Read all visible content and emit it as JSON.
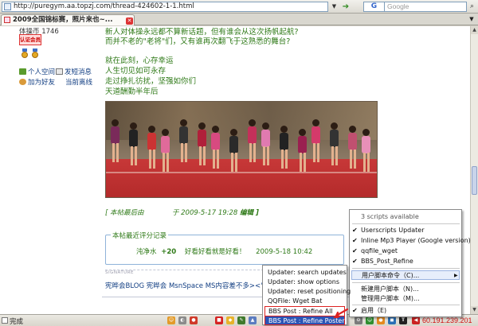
{
  "browser": {
    "url": "http://puregym.aa.topzj.com/thread-424602-1-1.html",
    "tab_title": "2009全国锦标赛，照片来也~...",
    "search_engine": "G",
    "search_placeholder": "Google"
  },
  "sidebar": {
    "location_text": "体操币 1746",
    "rank_badge": "认证会员",
    "links": [
      {
        "label": "个人空间",
        "icon": "home-icon"
      },
      {
        "label": "发短消息",
        "icon": "message-icon"
      },
      {
        "label": "加为好友",
        "icon": "add-friend-icon"
      },
      {
        "label": "当前离线",
        "icon": "offline-icon"
      }
    ]
  },
  "post": {
    "lines": [
      "新人对体操永远都不算新话题，但有谁会从这次扬帆起航?",
      "而并不老的\"老将\"们，又有谁再次翻飞于这熟悉的舞台?",
      "",
      "就在此刻，心存幸运",
      "人生切见如可永存",
      "走过挣扎彷扰，坚强如你们",
      "天道酬勤半年后"
    ],
    "edit_note_prefix": "[ 本帖最后由",
    "edit_note_time": "于 2009-5-17 19:28",
    "edit_note_suffix": "编辑 ]",
    "rating": {
      "title": "本帖最近评分记录",
      "user": "沌净水",
      "score": "+20",
      "comment": "好看好看就是好看！",
      "time": "2009-5-18 10:42"
    },
    "signature_label": "SIGNATURE",
    "signature_text": "宪晔会BLOG  宪晔会 MsnSpace  MS内容差不多><\""
  },
  "status_bar": {
    "status": "完成",
    "ip": "60.191.239.201"
  },
  "main_menu": {
    "header": "3 scripts available",
    "scripts": [
      {
        "label": "Userscripts Updater",
        "checked": true
      },
      {
        "label": "Inline Mp3 Player (Google version)",
        "checked": true
      },
      {
        "label": "qqfile_wget",
        "checked": true
      },
      {
        "label": "BBS_Post_Refine",
        "checked": true
      }
    ],
    "commands_label": "用户脚本命令（C)...",
    "new_script": "新建用户脚本（N)...",
    "manage_scripts": "管理用户脚本（M)...",
    "enabled": "启用（E)"
  },
  "sub_menu": {
    "items": [
      "Updater: search updates",
      "Updater: show options",
      "Updater: reset positioning",
      "QQFile: Wget Bat",
      "BBS Post : Refine All",
      "BBS Post : Refine Poster"
    ]
  },
  "colors": {
    "post_text": "#2f7a18",
    "link": "#103d82",
    "menu_highlight": "#2b54b5",
    "ip_text": "#d01010"
  }
}
